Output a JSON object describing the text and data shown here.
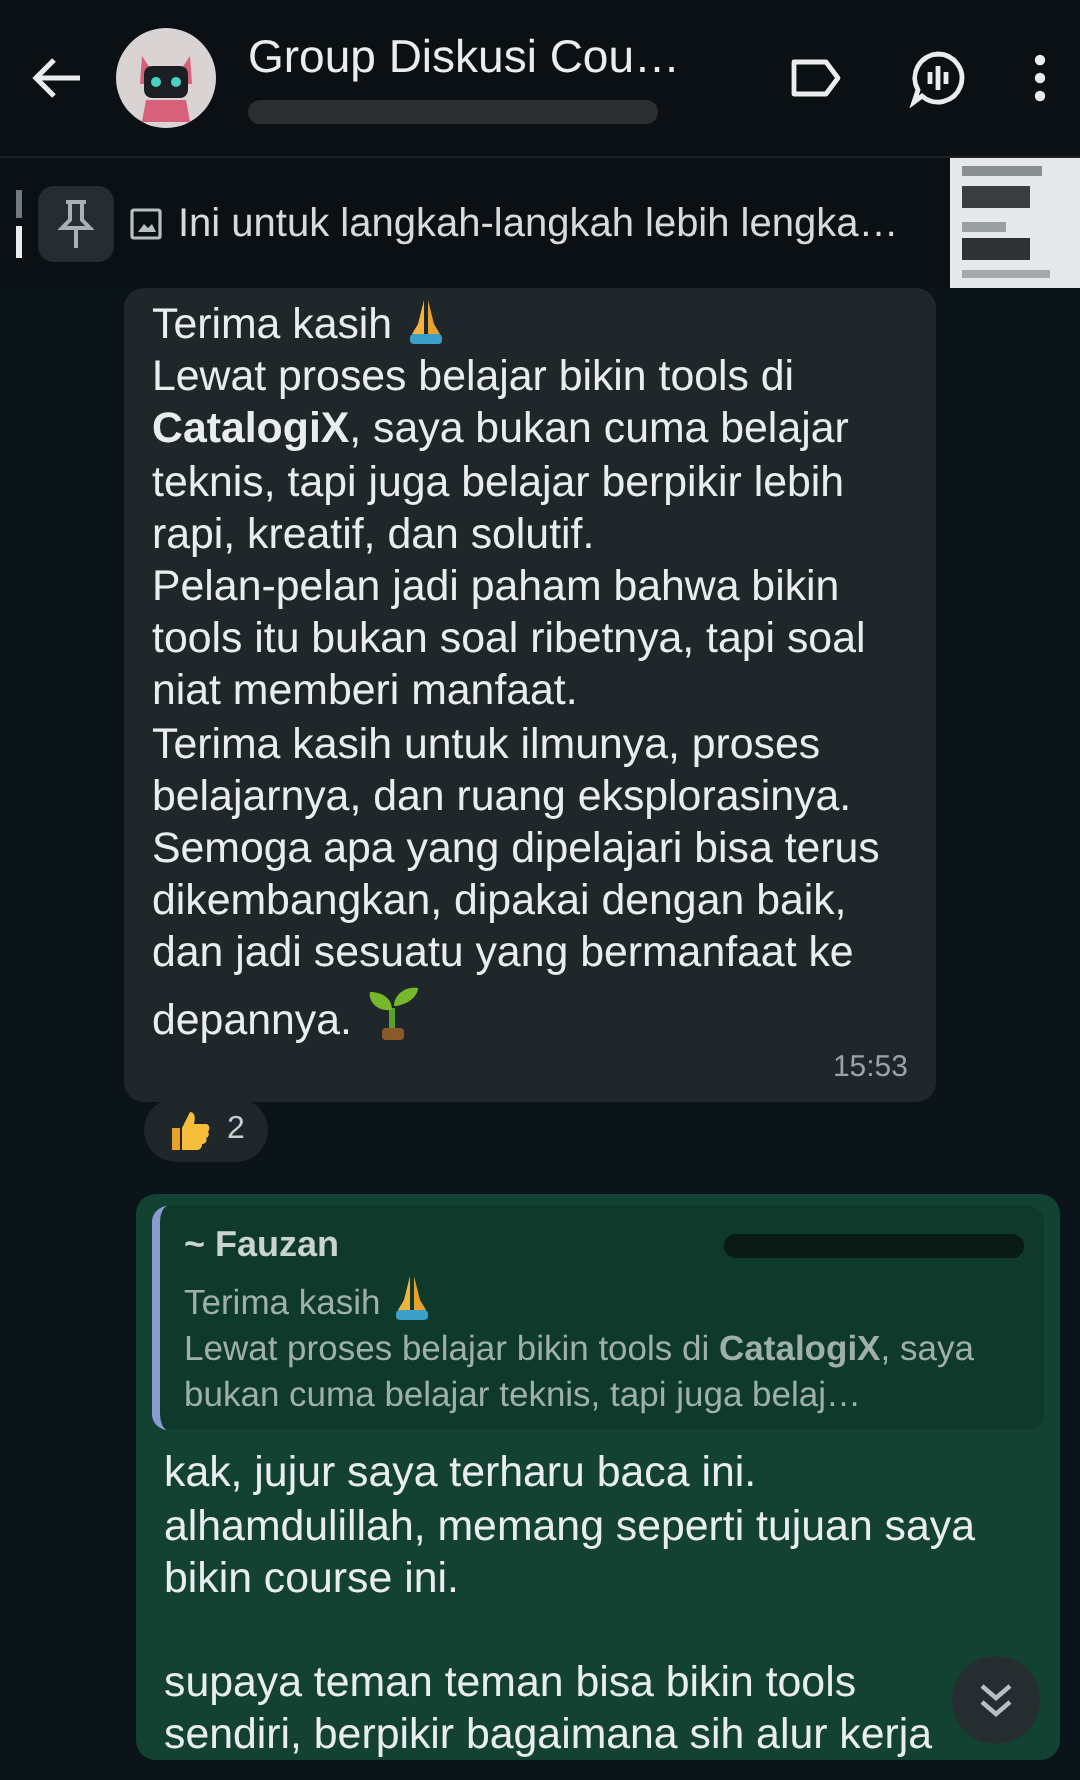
{
  "header": {
    "title": "Group Diskusi Cou…"
  },
  "pinned": {
    "text": "Ini untuk langkah-langkah lebih lengka…"
  },
  "messages": [
    {
      "kind": "incoming",
      "time": "15:53",
      "blocks": [
        {
          "kind": "pray",
          "text": "Terima kasih"
        },
        {
          "kind": "plain",
          "text": "Lewat proses belajar bikin tools di **CatalogiX**, saya bukan cuma belajar teknis, tapi juga belajar berpikir lebih rapi, kreatif, dan solutif."
        },
        {
          "kind": "plain",
          "text": "Pelan-pelan jadi paham bahwa bikin tools itu bukan soal ribetnya, tapi soal niat memberi manfaat."
        },
        {
          "kind": "plain",
          "text": "Terima kasih untuk ilmunya, proses belajarnya, dan ruang eksplorasinya."
        },
        {
          "kind": "sprout",
          "text": "Semoga apa yang dipelajari bisa terus dikembangkan, dipakai dengan baik, dan jadi sesuatu yang bermanfaat ke depannya."
        }
      ],
      "reaction": {
        "count": "2"
      }
    },
    {
      "kind": "outgoing",
      "quote": {
        "author": "~ Fauzan",
        "blocks": [
          {
            "kind": "pray",
            "text": "Terima kasih"
          },
          {
            "kind": "plain",
            "text": "Lewat proses belajar bikin tools di **CatalogiX**, saya bukan cuma belajar teknis, tapi juga belaj…"
          }
        ]
      },
      "blocks": [
        {
          "kind": "plain",
          "text": "kak, jujur saya terharu baca ini."
        },
        {
          "kind": "plain",
          "text": "alhamdulillah, memang seperti tujuan saya bikin course ini."
        },
        {
          "kind": "plain",
          "text": "supaya teman teman bisa bikin tools sendiri, berpikir bagaimana sih alur kerja",
          "gap_before": true
        }
      ]
    }
  ]
}
